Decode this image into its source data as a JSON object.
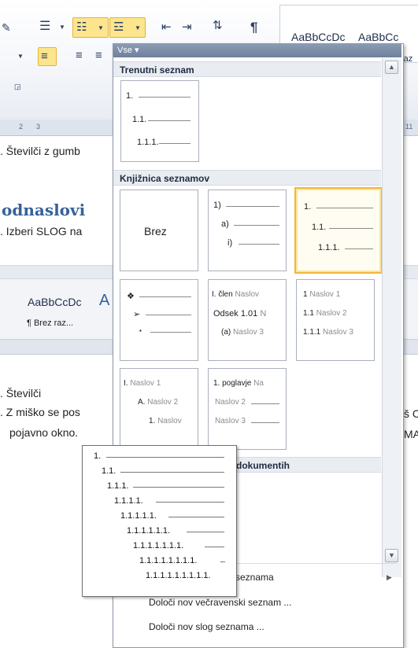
{
  "ribbon": {
    "style_samples": [
      "AaBbCcDc",
      "AaBbCc"
    ],
    "style_partial": "raz",
    "ruler_marks": [
      "2",
      "3"
    ],
    "ruler_right": "11"
  },
  "document": {
    "line1": ". Številči z gumb",
    "heading": "odnaslovi",
    "line2": ". Izberi SLOG na",
    "embed_sample": "AaBbCcDc",
    "embed_sample_big": "A",
    "embed_style": "¶ Brez raz...",
    "line3": ". Številči",
    "line4": ". Z miško se pos",
    "line5": "pojavno okno.",
    "right_frag1": "š C",
    "right_frag2": "MA"
  },
  "panel": {
    "filter_label": "Vse ▾",
    "current_header": "Trenutni seznam",
    "library_header": "Knjižnica seznamov",
    "docs_header": "dokumentih",
    "current_tile": [
      "1.",
      "1.1.",
      "1.1.1."
    ],
    "tiles": [
      {
        "id": "none",
        "lines": [
          "Brez"
        ]
      },
      {
        "id": "paren",
        "lines": [
          "1)",
          "a)",
          "i)"
        ]
      },
      {
        "id": "decimal",
        "lines": [
          "1.",
          "1.1.",
          "1.1.1."
        ]
      },
      {
        "id": "bullets",
        "lines": [
          "❖",
          "➢",
          "▪"
        ]
      },
      {
        "id": "clen",
        "lines": [
          "I. člen",
          "Naslov",
          "Odsek 1.01",
          "N",
          "(a)",
          "Naslov 3"
        ]
      },
      {
        "id": "naslov-num",
        "lines": [
          "1",
          "Naslov 1",
          "1.1",
          "Naslov 2",
          "1.1.1",
          "Naslov 3"
        ]
      },
      {
        "id": "roman",
        "lines": [
          "I.",
          "Naslov 1",
          "A.",
          "Naslov 2",
          "1.",
          "Naslov"
        ]
      },
      {
        "id": "poglavje",
        "lines": [
          "1. poglavje",
          "Na",
          "Naslov 2",
          "Naslov 3"
        ]
      }
    ],
    "menu": {
      "item1": "seznama",
      "item2": "Določi nov večravenski seznam ...",
      "item3": "Določi nov slog seznama ..."
    }
  },
  "popup": {
    "levels": [
      "1.",
      "1.1.",
      "1.1.1.",
      "1.1.1.1.",
      "1.1.1.1.1.",
      "1.1.1.1.1.1.",
      "1.1.1.1.1.1.1.",
      "1.1.1.1.1.1.1.1.",
      "1.1.1.1.1.1.1.1.1."
    ]
  }
}
